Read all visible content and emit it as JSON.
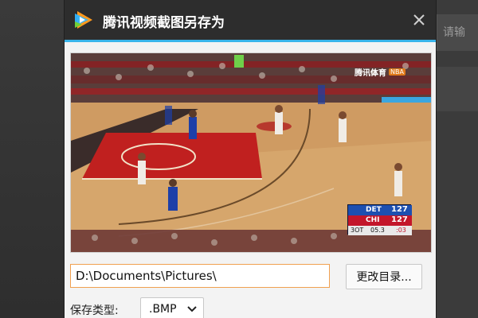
{
  "background_app": {
    "right_field_hint": "请输"
  },
  "dialog": {
    "title": "腾讯视频截图另存为",
    "close_label": "✕",
    "preview": {
      "watermark": "腾讯体育",
      "watermark_badge": "NBA",
      "scoreboard": {
        "team1": "DET",
        "score1": "127",
        "team2": "CHI",
        "score2": "127",
        "period": "3OT",
        "clock": "05.3",
        "shot_clock": ":03"
      }
    },
    "save_path": "D:\\Documents\\Pictures\\",
    "browse_label": "更改目录...",
    "save_type_label": "保存类型:",
    "save_type_value": ".BMP"
  },
  "colors": {
    "titlebar": "#2d2d2d",
    "accent": "#39b4ea",
    "input_border": "#f0a050"
  }
}
